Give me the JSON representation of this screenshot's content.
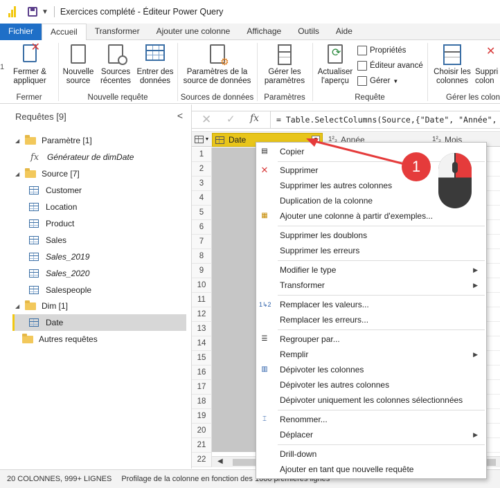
{
  "window": {
    "title": "Exercices complété - Éditeur Power Query"
  },
  "tabs": [
    "Fichier",
    "Accueil",
    "Transformer",
    "Ajouter une colonne",
    "Affichage",
    "Outils",
    "Aide"
  ],
  "ribbon": {
    "close_apply": "Fermer &\nappliquer",
    "group_fermer": "Fermer",
    "new_source": "Nouvelle\nsource",
    "recent_sources": "Sources\nrécentes",
    "enter_data": "Entrer des\ndonnées",
    "group_new_query": "Nouvelle requête",
    "datasource_settings": "Paramètres de la\nsource de données",
    "group_data_sources": "Sources de données",
    "manage_params": "Gérer les\nparamètres",
    "group_params": "Paramètres",
    "refresh_preview": "Actualiser\nl'aperçu",
    "properties": "Propriétés",
    "advanced_editor": "Éditeur avancé",
    "manage": "Gérer",
    "group_query": "Requête",
    "choose_columns": "Choisir les\ncolonnes",
    "remove_columns": "Suppri\ncolon",
    "group_manage_columns": "Gérer les colon"
  },
  "queries": {
    "header": "Requêtes [9]",
    "items": [
      {
        "type": "folder",
        "label": "Paramètre [1]"
      },
      {
        "type": "fx",
        "label": "Générateur de dimDate",
        "italic": true
      },
      {
        "type": "folder",
        "label": "Source [7]"
      },
      {
        "type": "table",
        "label": "Customer"
      },
      {
        "type": "table",
        "label": "Location"
      },
      {
        "type": "table",
        "label": "Product"
      },
      {
        "type": "table",
        "label": "Sales"
      },
      {
        "type": "table",
        "label": "Sales_2019",
        "italic": true
      },
      {
        "type": "table",
        "label": "Sales_2020",
        "italic": true
      },
      {
        "type": "table",
        "label": "Salespeople"
      },
      {
        "type": "folder",
        "label": "Dim [1]"
      },
      {
        "type": "table",
        "label": "Date",
        "selected": true
      },
      {
        "type": "folder-plain",
        "label": "Autres requêtes"
      }
    ]
  },
  "formula": {
    "code": "= Table.SelectColumns(Source,{\"Date\", \"Année\", \"M"
  },
  "grid": {
    "columns": [
      {
        "type_label": "",
        "name": "Date"
      },
      {
        "type_label": "1²₃",
        "name": "Année"
      },
      {
        "type_label": "1²₃",
        "name": "Mois"
      }
    ],
    "rows": [
      "1",
      "2",
      "3",
      "4",
      "5",
      "6",
      "7",
      "8",
      "9",
      "10",
      "11",
      "12",
      "13",
      "14",
      "15",
      "16",
      "17",
      "18",
      "19",
      "20",
      "21",
      "22"
    ]
  },
  "status": {
    "columns_rows": "20 COLONNES, 999+ LIGNES",
    "profiling": "Profilage de la colonne en fonction des 1000 premières lignes"
  },
  "context_menu": [
    {
      "label": "Copier",
      "icon": "copy-icon"
    },
    {
      "label": "Supprimer",
      "icon": "delete-icon"
    },
    {
      "label": "Supprimer les autres colonnes"
    },
    {
      "label": "Duplication de la colonne"
    },
    {
      "label": "Ajouter une colonne à partir d'exemples...",
      "icon": "add-column-icon"
    },
    {
      "label": "Supprimer les doublons"
    },
    {
      "label": "Supprimer les erreurs"
    },
    {
      "label": "Modifier le type",
      "submenu": true
    },
    {
      "label": "Transformer",
      "submenu": true
    },
    {
      "label": "Remplacer les valeurs...",
      "icon": "replace-icon"
    },
    {
      "label": "Remplacer les erreurs..."
    },
    {
      "label": "Regrouper par...",
      "icon": "group-icon"
    },
    {
      "label": "Remplir",
      "submenu": true
    },
    {
      "label": "Dépivoter les colonnes",
      "icon": "unpivot-icon"
    },
    {
      "label": "Dépivoter les autres colonnes"
    },
    {
      "label": "Dépivoter uniquement les colonnes sélectionnées"
    },
    {
      "label": "Renommer...",
      "icon": "rename-icon"
    },
    {
      "label": "Déplacer",
      "submenu": true
    },
    {
      "label": "Drill-down"
    },
    {
      "label": "Ajouter en tant que nouvelle requête"
    }
  ],
  "annotation": {
    "badge": "1"
  },
  "colors": {
    "accent_blue": "#1f6fc7",
    "selected_header": "#e8c51a",
    "badge_red": "#e53b3b"
  },
  "left_edge_numbers": [
    "1",
    "2"
  ]
}
